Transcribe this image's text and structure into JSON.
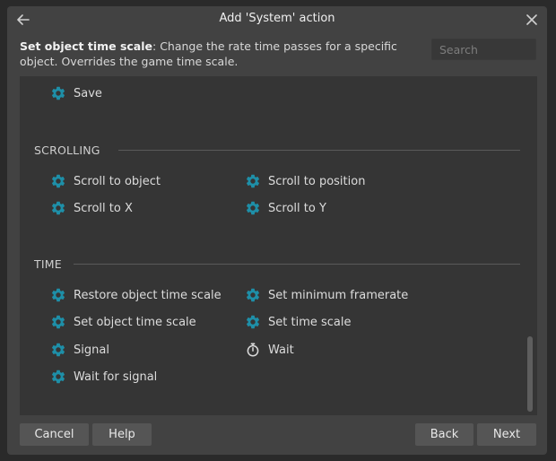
{
  "dialog": {
    "title": "Add 'System' action",
    "description_bold": "Set object time scale",
    "description_rest": ": Change the rate time passes for a specific object. Overrides the game time scale.",
    "search_placeholder": "Search"
  },
  "list": {
    "top_items": [
      {
        "label": "Save",
        "icon": "gear-icon"
      }
    ],
    "sections": [
      {
        "title": "SCROLLING",
        "items": [
          {
            "label": "Scroll to object",
            "icon": "gear-icon"
          },
          {
            "label": "Scroll to position",
            "icon": "gear-icon"
          },
          {
            "label": "Scroll to X",
            "icon": "gear-icon"
          },
          {
            "label": "Scroll to Y",
            "icon": "gear-icon"
          }
        ]
      },
      {
        "title": "TIME",
        "items": [
          {
            "label": "Restore object time scale",
            "icon": "gear-icon"
          },
          {
            "label": "Set minimum framerate",
            "icon": "gear-icon"
          },
          {
            "label": "Set object time scale",
            "icon": "gear-icon"
          },
          {
            "label": "Set time scale",
            "icon": "gear-icon"
          },
          {
            "label": "Signal",
            "icon": "gear-icon"
          },
          {
            "label": "Wait",
            "icon": "stopwatch-icon"
          },
          {
            "label": "Wait for signal",
            "icon": "gear-icon"
          }
        ]
      }
    ]
  },
  "buttons": {
    "cancel": "Cancel",
    "help": "Help",
    "back": "Back",
    "next": "Next"
  },
  "colors": {
    "gear_icon": "#1e8fa8",
    "list_background": "#353535",
    "dialog_background": "#424242",
    "button_background": "#555555"
  }
}
